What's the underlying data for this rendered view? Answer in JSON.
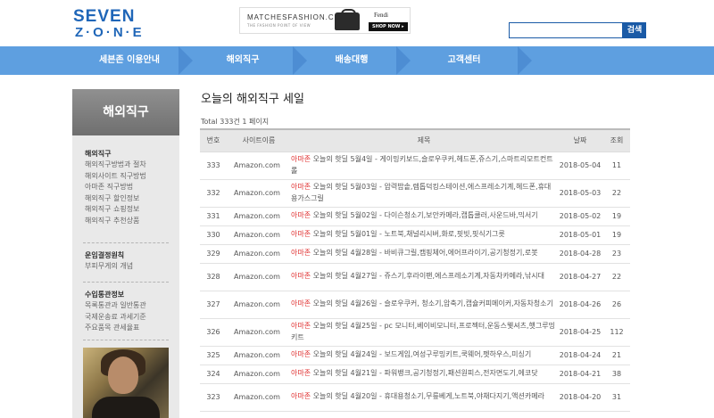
{
  "header": {
    "logo_top": "SEVEN",
    "logo_bottom": "Z·O·N·E",
    "banner": {
      "brand": "MATCHESFASHION.COM",
      "tagline": "THE FASHION POINT OF VIEW",
      "label": "Fendi",
      "cta": "SHOP NOW ▸"
    },
    "search": {
      "placeholder": "",
      "button_label": "검색"
    }
  },
  "nav": {
    "items": [
      {
        "label": "세븐존 이용안내"
      },
      {
        "label": "해외직구"
      },
      {
        "label": "배송대행"
      },
      {
        "label": "고객센터"
      }
    ],
    "colors": {
      "bar": "#5e9fe0",
      "chevron": "#4d8dd3"
    }
  },
  "sidebar": {
    "title": "해외직구",
    "groups": [
      {
        "heading": "해외직구",
        "items": [
          "해외직구방법과 절차",
          "해외사이트 직구방법",
          "아마존 직구방법",
          "해외직구 할인정보",
          "해외직구 쇼핑정보",
          "해외직구 추천상품"
        ]
      },
      {
        "heading": "운임결정원칙",
        "items": [
          "부피무게의 개념"
        ]
      },
      {
        "heading": "수입통관정보",
        "items": [
          "목록통관과 일반통관",
          "국제운송료 과세기준",
          "주요품목 관세율표"
        ]
      }
    ]
  },
  "main": {
    "title": "오늘의 해외직구 세일",
    "total_text": "Total 333건 1 페이지",
    "columns": [
      "번호",
      "사이트이름",
      "제목",
      "날짜",
      "조회"
    ],
    "rows": [
      {
        "no": "333",
        "site": "Amazon.com",
        "shop": "아마존",
        "title": " 오늘의 핫딜 5월4일 - 게이밍키보드,슬로우쿠커,헤드폰,쥬스기,스마트리모트컨트롤",
        "date": "2018-05-04",
        "views": "11"
      },
      {
        "no": "332",
        "site": "Amazon.com",
        "shop": "아마존",
        "title": " 오늘의 핫딜 5월03일 - 압력밥솥,렙톱덕킹스테이션,에스프레소기계,헤드폰,휴대용가스그릴",
        "date": "2018-05-03",
        "views": "22"
      },
      {
        "no": "331",
        "site": "Amazon.com",
        "shop": "아마존",
        "title": " 오늘의 핫딜 5월02일 - 다이슨청소기,보안카메라,캡톱쿨러,사운드바,믹서기",
        "date": "2018-05-02",
        "views": "19"
      },
      {
        "no": "330",
        "site": "Amazon.com",
        "shop": "아마존",
        "title": " 오늘의 핫딜 5월01일 - 노트북,채널리시버,화로,핏빗,핏식기그릇",
        "date": "2018-05-01",
        "views": "19"
      },
      {
        "no": "329",
        "site": "Amazon.com",
        "shop": "아마존",
        "title": " 오늘의 핫딜 4월28일 - 바비큐그릴,캠핑체어,에어프라이기,공기청정기,로봇",
        "date": "2018-04-28",
        "views": "23"
      },
      {
        "no": "328",
        "site": "Amazon.com",
        "shop": "아마존",
        "title": " 오늘의 핫딜 4월27일 - 쥬스기,후라이팬,에스프레소기계,자동차카메라,낚시대",
        "date": "2018-04-27",
        "views": "22"
      },
      {
        "no": "327",
        "site": "Amazon.com",
        "shop": "아마존",
        "title": " 오늘의 핫딜 4월26일 - 슬로우쿠커, 청소기,압축기,캡슐커피메이커,자동차청소기",
        "date": "2018-04-26",
        "views": "26"
      },
      {
        "no": "326",
        "site": "Amazon.com",
        "shop": "아마존",
        "title": " 오늘의 핫딜 4월25일 - pc 모니터,베이비모니터,프로젝터,운동스웻셔츠,햇그루밍키트",
        "date": "2018-04-25",
        "views": "112"
      },
      {
        "no": "325",
        "site": "Amazon.com",
        "shop": "아마존",
        "title": " 오늘의 핫딜 4월24일 - 보드게임,여성구루밍키트,쿡웨어,펫하우스,미싱기",
        "date": "2018-04-24",
        "views": "21"
      },
      {
        "no": "324",
        "site": "Amazon.com",
        "shop": "아마존",
        "title": " 오늘의 핫딜 4월21일 - 파워뱅크,공기청정기,패션원피스,전자면도기,에코닷",
        "date": "2018-04-21",
        "views": "38"
      },
      {
        "no": "323",
        "site": "Amazon.com",
        "shop": "아마존",
        "title": " 오늘의 핫딜 4월20일 - 휴대용청소기,무릎베게,노트북,야채다지기,액션카메라",
        "date": "2018-04-20",
        "views": "31"
      }
    ]
  }
}
